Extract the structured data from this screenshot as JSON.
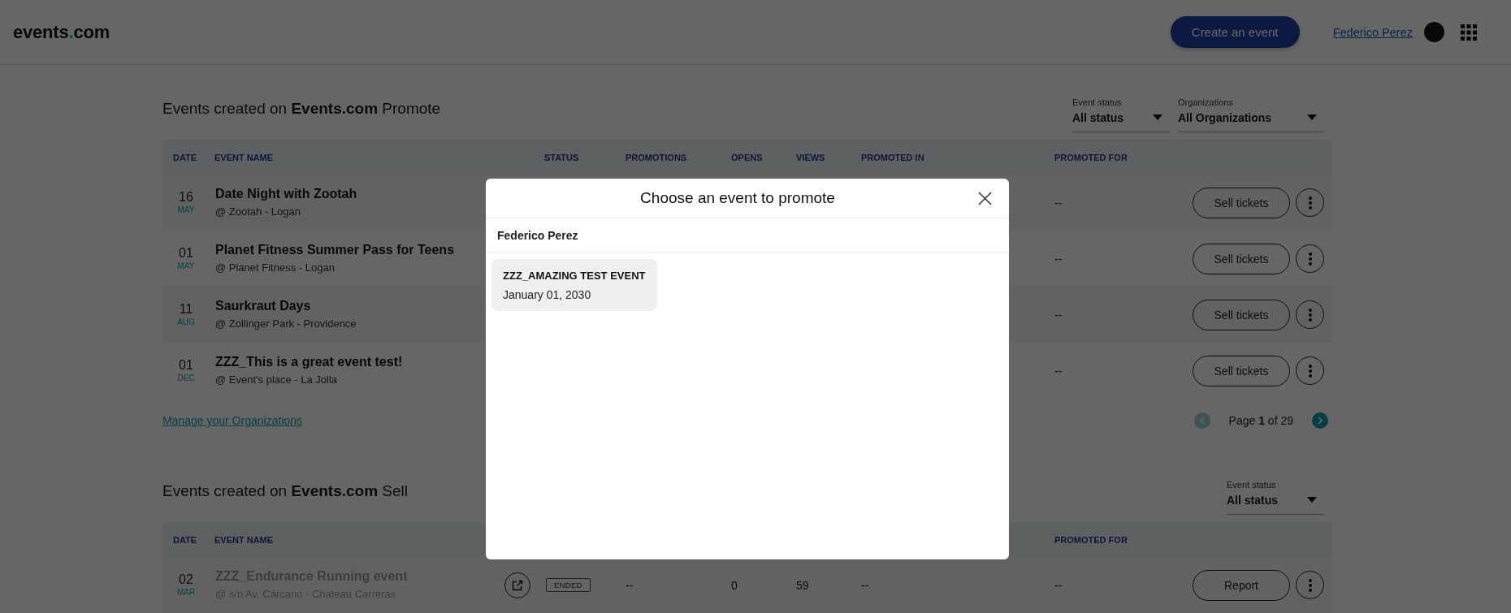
{
  "header": {
    "logo": {
      "text": "events",
      "accent": ".",
      "suffix": "com"
    },
    "create_button": "Create an event",
    "user_name": "Federico Perez"
  },
  "promote_section": {
    "title": "Events created on **Events.com** Promote",
    "filters": [
      {
        "label": "Event status",
        "value": "All status"
      },
      {
        "label": "Organizations",
        "value": "All Organizations"
      }
    ],
    "columns": {
      "date": "DATE",
      "event_name": "EVENT NAME",
      "status": "STATUS",
      "promotions": "PROMOTIONS",
      "opens": "OPENS",
      "views": "VIEWS",
      "promoted_in": "PROMOTED IN",
      "promoted_for": "PROMOTED FOR"
    },
    "rows": [
      {
        "day": "16",
        "month": "MAY",
        "name": "Date Night with Zootah",
        "venue": "@ Zootah - Logan",
        "ended": false,
        "promoted_for": "--",
        "action": "Sell tickets"
      },
      {
        "day": "01",
        "month": "MAY",
        "name": "Planet Fitness Summer Pass for Teens",
        "venue": "@ Planet Fitness - Logan",
        "ended": false,
        "promoted_for": "--",
        "action": "Sell tickets"
      },
      {
        "day": "11",
        "month": "AUG",
        "name": "Saurkraut Days",
        "venue": "@ Zollinger Park - Providence",
        "ended": false,
        "promoted_for": "--",
        "action": "Sell tickets"
      },
      {
        "day": "01",
        "month": "DEC",
        "name": "ZZZ_This is a great event test!",
        "venue": "@ Event's place - La Jolla",
        "ended": false,
        "promoted_for": "--",
        "action": "Sell tickets"
      }
    ],
    "manage_link": "Manage your Organizations",
    "pagination": {
      "text": "Page **1** of 29",
      "prev": {
        "disabled": true
      },
      "next": {
        "disabled": false
      }
    }
  },
  "sell_section": {
    "title": "Events created on **Events.com** Sell",
    "filters": [
      {
        "label": "Event status",
        "value": "All status"
      }
    ],
    "columns": {
      "date": "DATE",
      "event_name": "EVENT NAME",
      "promoted_for": "PROMOTED FOR"
    },
    "rows": [
      {
        "day": "02",
        "month": "MAR",
        "name": "ZZZ_Endurance Running event",
        "venue": "@ s/n Av. Cárcano - Chateau Carreras",
        "ended": true,
        "status": "ENDED",
        "promotions": "--",
        "opens": "0",
        "views": "59",
        "promoted_in": "--",
        "promoted_for": "--",
        "action": "Report"
      }
    ]
  },
  "modal": {
    "title": "Choose an event to promote",
    "owner": "Federico Perez",
    "events": [
      {
        "name": "ZZZ_AMAZING TEST EVENT",
        "date": "January 01, 2030"
      }
    ]
  }
}
